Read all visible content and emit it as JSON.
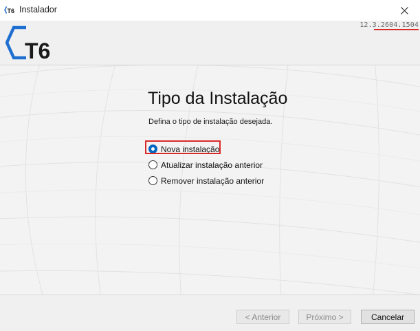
{
  "window": {
    "title": "Instalador",
    "close_icon": "close-icon",
    "title_icon": "t6-app-icon"
  },
  "header": {
    "logo_text": "T6",
    "version": "12.3.2604.1504",
    "accent_color": "#1f6fd1",
    "highlight_color": "#d92a2a"
  },
  "main": {
    "title": "Tipo da Instalação",
    "description": "Defina o tipo de instalação desejada.",
    "options": [
      {
        "label": "Nova instalação",
        "selected": true
      },
      {
        "label": "Atualizar instalação anterior",
        "selected": false
      },
      {
        "label": "Remover instalação anterior",
        "selected": false
      }
    ]
  },
  "footer": {
    "prev_label": "< Anterior",
    "next_label": "Próximo >",
    "cancel_label": "Cancelar",
    "prev_enabled": false,
    "next_enabled": false,
    "cancel_enabled": true
  }
}
